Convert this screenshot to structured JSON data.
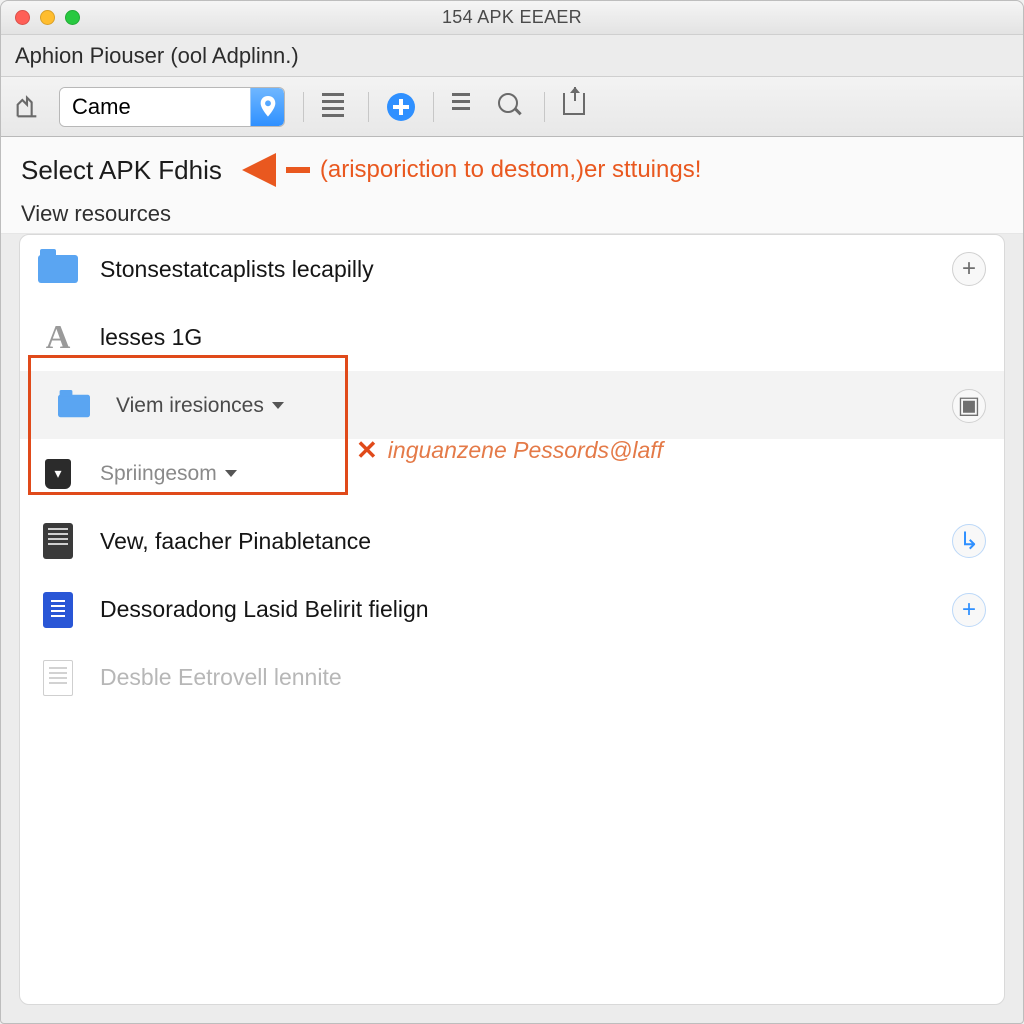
{
  "window": {
    "title": "154 APK EEAER"
  },
  "breadcrumb": "Aphion Piouser (ool Adplinn.)",
  "toolbar": {
    "picker_value": "Came",
    "icons": {
      "hand": "hand-tool-icon",
      "pin": "location-pin-icon",
      "list": "list-view-icon",
      "add": "add-icon",
      "align": "align-icon",
      "zoom": "zoom-icon",
      "export": "export-icon"
    }
  },
  "heading": {
    "title": "Select APK Fdhis",
    "callout": "(arisporiction to destom,)er sttuings!",
    "subtitle": "View resources"
  },
  "rows": [
    {
      "kind": "folder",
      "label": "Stonsestatcaplists lecapilly",
      "action": "plus"
    },
    {
      "kind": "font",
      "label": "lesses 1G"
    },
    {
      "kind": "folder-small",
      "label": "Viem iresionces",
      "dropdown": true,
      "action": "app"
    },
    {
      "kind": "shield",
      "label": "Spriingesom",
      "dropdown": true
    },
    {
      "kind": "doc-dark",
      "label": "Vew, faacher Pinabletance",
      "action": "blueplus"
    },
    {
      "kind": "doc-blue",
      "label": "Dessoradong Lasid Belirit fielign",
      "action": "blueplus"
    },
    {
      "kind": "page",
      "label": "Desble Eetrovell lennite",
      "muted": true
    }
  ],
  "annotation": {
    "x": "✕",
    "text": "inguanzene Pessords@laff"
  },
  "colors": {
    "accent": "#e9581f",
    "link": "#2f90ff"
  }
}
